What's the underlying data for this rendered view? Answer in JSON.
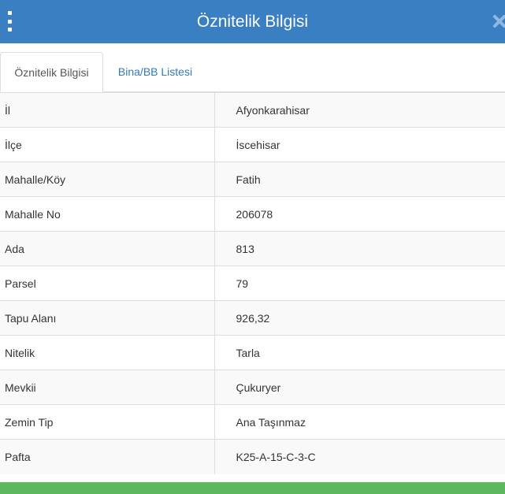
{
  "header": {
    "title": "Öznitelik Bilgisi",
    "menu_icon": "vertical-ellipsis-icon",
    "close_icon": "close-icon"
  },
  "tabs": [
    {
      "label": "Öznitelik Bilgisi",
      "active": true
    },
    {
      "label": "Bina/BB Listesi",
      "active": false
    }
  ],
  "attributes": [
    {
      "label": "İl",
      "value": "Afyonkarahisar"
    },
    {
      "label": "İlçe",
      "value": "İscehisar"
    },
    {
      "label": "Mahalle/Köy",
      "value": "Fatih"
    },
    {
      "label": "Mahalle No",
      "value": "206078"
    },
    {
      "label": "Ada",
      "value": "813"
    },
    {
      "label": "Parsel",
      "value": "79"
    },
    {
      "label": "Tapu Alanı",
      "value": "926,32"
    },
    {
      "label": "Nitelik",
      "value": "Tarla"
    },
    {
      "label": "Mevkii",
      "value": "Çukuryer"
    },
    {
      "label": "Zemin Tip",
      "value": "Ana Taşınmaz"
    },
    {
      "label": "Pafta",
      "value": "K25-A-15-C-3-C"
    }
  ],
  "colors": {
    "header_bg": "#3a7fc1",
    "link": "#337ab7",
    "footer_bar": "#5cb85c"
  }
}
